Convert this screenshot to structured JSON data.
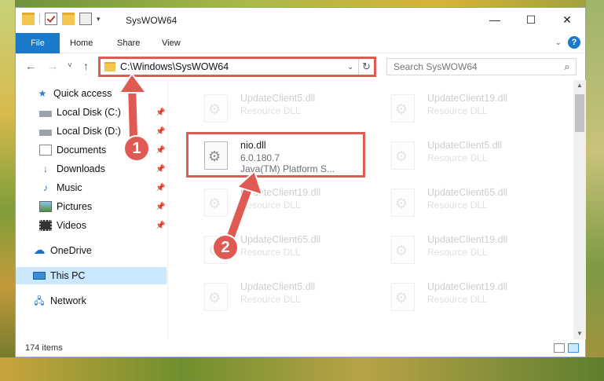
{
  "window": {
    "title": "SysWOW64",
    "controls": {
      "minimize": "—",
      "maximize": "☐",
      "close": "✕"
    }
  },
  "ribbon": {
    "tabs": [
      "File",
      "Home",
      "Share",
      "View"
    ],
    "help": "?"
  },
  "address": {
    "path": "C:\\Windows\\SysWOW64",
    "refresh": "↻"
  },
  "search": {
    "placeholder": "Search SysWOW64"
  },
  "nav": {
    "back": "←",
    "forward": "→",
    "recent": "˅",
    "up": "↑"
  },
  "sidebar": {
    "items": [
      {
        "label": "Quick access",
        "icon": "star-icon",
        "pinned": false
      },
      {
        "label": "Local Disk (C:)",
        "icon": "disk-icon",
        "pinned": true
      },
      {
        "label": "Local Disk (D:)",
        "icon": "disk-icon",
        "pinned": true
      },
      {
        "label": "Documents",
        "icon": "documents-icon",
        "pinned": true
      },
      {
        "label": "Downloads",
        "icon": "download-icon",
        "pinned": true
      },
      {
        "label": "Music",
        "icon": "music-icon",
        "pinned": true
      },
      {
        "label": "Pictures",
        "icon": "pictures-icon",
        "pinned": true
      },
      {
        "label": "Videos",
        "icon": "videos-icon",
        "pinned": true
      },
      {
        "label": "OneDrive",
        "icon": "cloud-icon",
        "pinned": false
      },
      {
        "label": "This PC",
        "icon": "computer-icon",
        "pinned": false,
        "selected": true
      },
      {
        "label": "Network",
        "icon": "network-icon",
        "pinned": false
      }
    ]
  },
  "files": [
    {
      "name": "UpdateClient5.dll",
      "type": "Resource DLL",
      "faded": true
    },
    {
      "name": "UpdateClient19.dll",
      "type": "Resource DLL",
      "faded": true
    },
    {
      "name": "nio.dll",
      "version": "6.0.180.7",
      "type": "Java(TM) Platform S...",
      "faded": false
    },
    {
      "name": "UpdateClient5.dll",
      "type": "Resource DLL",
      "faded": true
    },
    {
      "name": "UpdateClient19.dll",
      "type": "Resource DLL",
      "faded": true
    },
    {
      "name": "UpdateClient65.dll",
      "type": "Resource DLL",
      "faded": true
    },
    {
      "name": "UpdateClient65.dll",
      "type": "Resource DLL",
      "faded": true
    },
    {
      "name": "UpdateClient19.dll",
      "type": "Resource DLL",
      "faded": true
    },
    {
      "name": "UpdateClient5.dll",
      "type": "Resource DLL",
      "faded": true
    },
    {
      "name": "UpdateClient19.dll",
      "type": "Resource DLL",
      "faded": true
    }
  ],
  "status": {
    "item_count": "174 items"
  },
  "annotations": {
    "step1": "1",
    "step2": "2",
    "color": "#e05a54"
  }
}
